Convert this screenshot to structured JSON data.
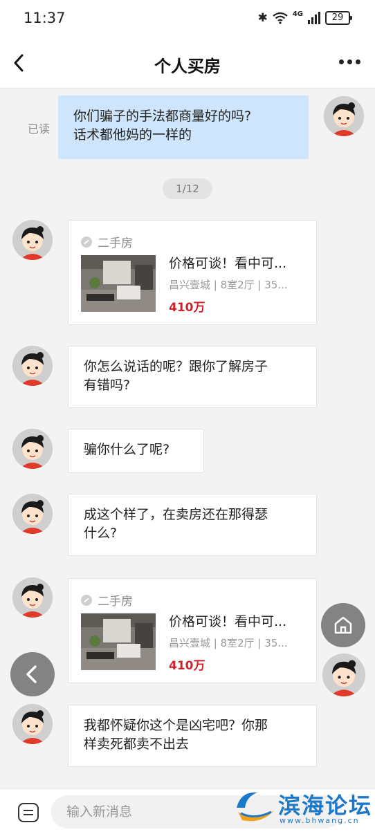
{
  "status": {
    "time": "11:37",
    "network": "4G",
    "battery": "29"
  },
  "header": {
    "title": "个人买房"
  },
  "messages": {
    "m0": {
      "line1": "你们骗子的手法都商量好的吗?",
      "line2": "话术都他妈的一样的",
      "read": "已读"
    },
    "pager": "1/12",
    "card1": {
      "tag": "二手房",
      "title": "价格可谈！看中可...",
      "sub": "昌兴壹城 | 8室2厅 | 35...",
      "price": "410万"
    },
    "m2": {
      "line1": "你怎么说话的呢？跟你了解房子",
      "line2": "有错吗?"
    },
    "m3": {
      "text": "骗你什么了呢?"
    },
    "m4": {
      "line1": "成这个样了，在卖房还在那得瑟",
      "line2": "什么?"
    },
    "card2": {
      "tag": "二手房",
      "title": "价格可谈！看中可...",
      "sub": "昌兴壹城 | 8室2厅 | 35...",
      "price": "410万"
    },
    "m6": {
      "line1": "我都怀疑你这个是凶宅吧？你那",
      "line2": "样卖死都卖不出去"
    }
  },
  "input": {
    "placeholder": "输入新消息"
  },
  "watermark": {
    "text": "滨海论坛",
    "url": "www.bhwang.cn"
  },
  "colors": {
    "bubble_mine": "#cfe5fb",
    "price": "#d0202c",
    "logo": "#1c78c8"
  }
}
